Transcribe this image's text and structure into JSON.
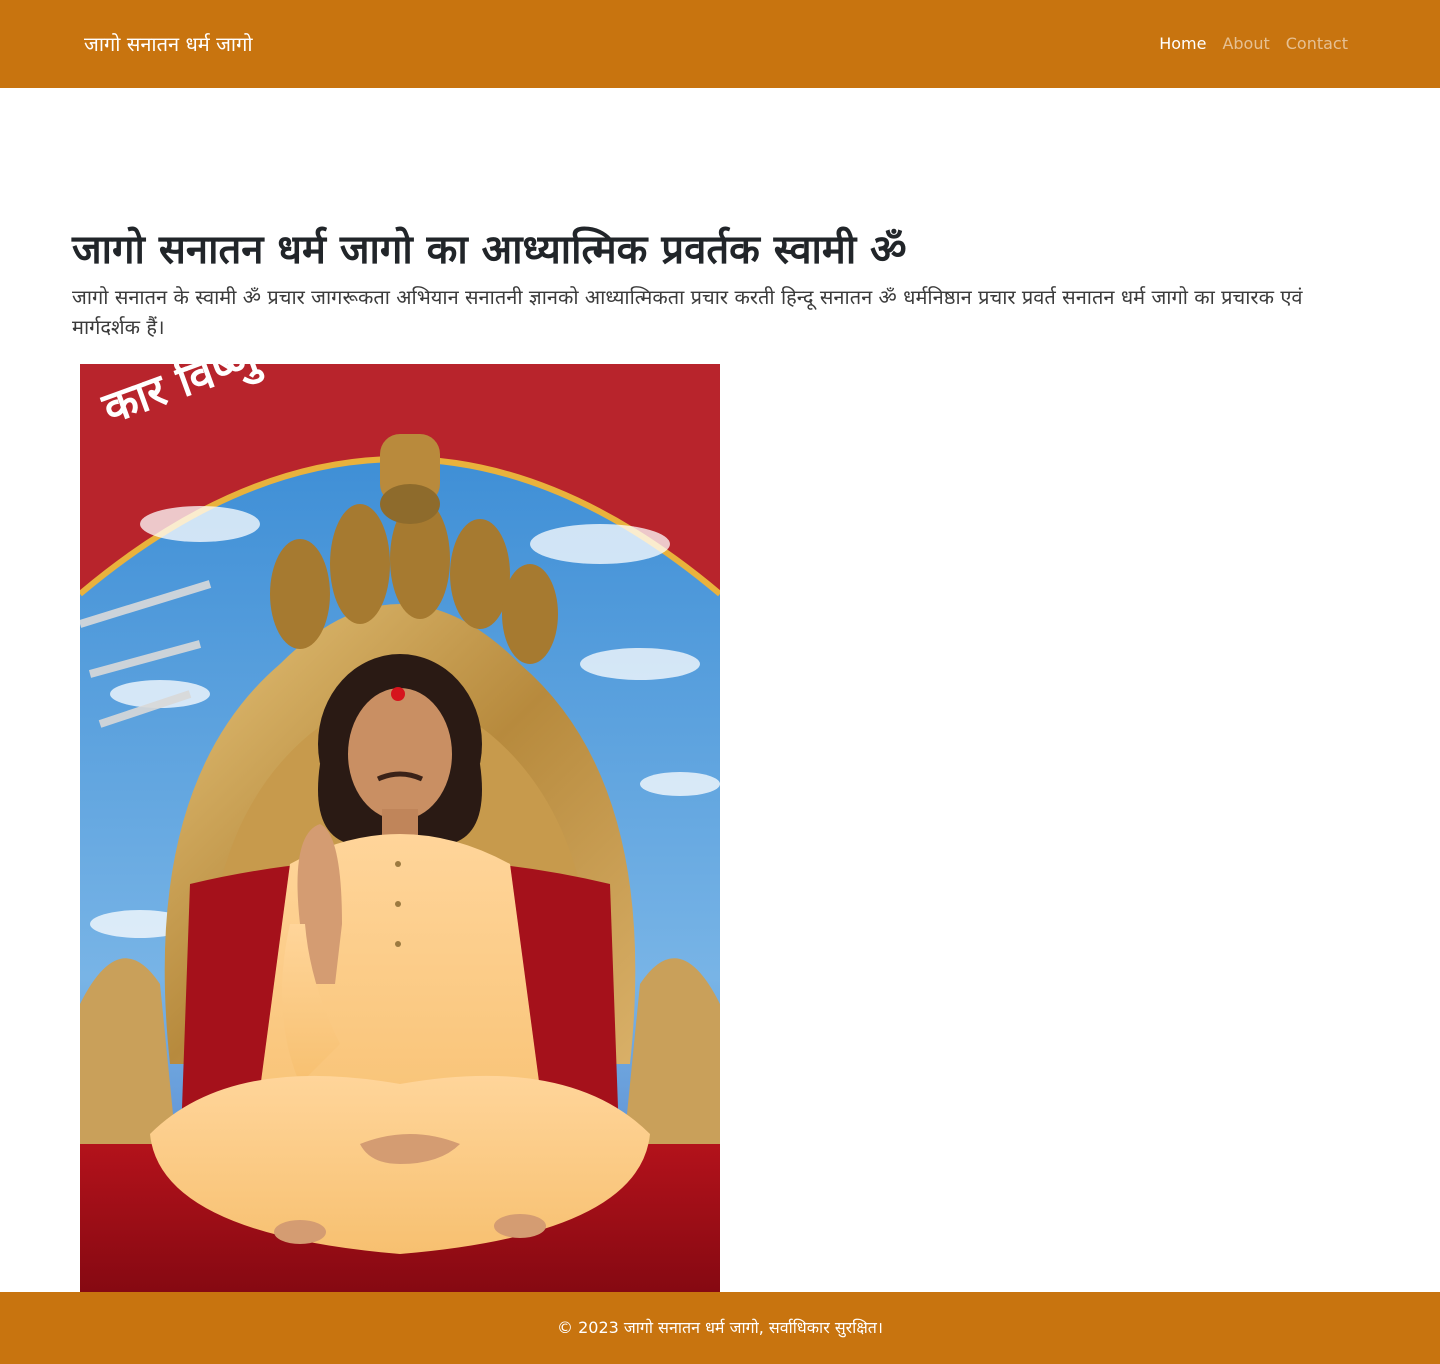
{
  "navbar": {
    "brand": "जागो सनातन धर्म जागो",
    "links": [
      {
        "label": "Home",
        "active": true
      },
      {
        "label": "About",
        "active": false
      },
      {
        "label": "Contact",
        "active": false
      }
    ],
    "background_color": "#c8740f"
  },
  "main": {
    "heading": "जागो सनातन धर्म जागो का आध्यात्मिक प्रवर्तक स्वामी ॐ",
    "lead": "जागो सनातन के स्वामी ॐ प्रचार जागरूकता अभियान सनातनी ज्ञानको आध्यात्मिकता प्रचार करती हिन्दू सनातन ॐ धर्मनिष्ठान प्रचार प्रवर्त सनातन धर्म जागो का प्रचारक एवं मार्गदर्शक हैं।",
    "image": {
      "alt": "Seated spiritual teacher in saffron robes on golden serpent throne",
      "banner_text": "कार विष्णु शिव शक्ति"
    }
  },
  "footer": {
    "text": "© 2023 जागो सनातन धर्म जागो, सर्वाधिकार सुरक्षित।",
    "background_color": "#c8740f"
  }
}
